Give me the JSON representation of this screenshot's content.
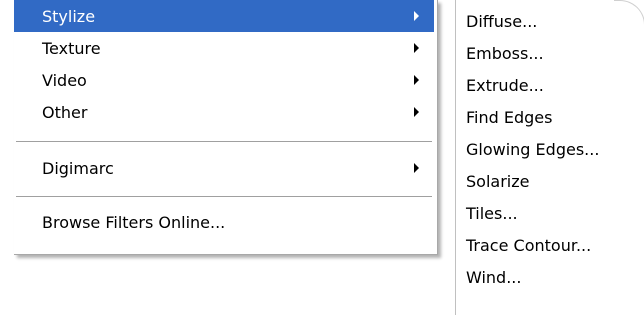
{
  "menu": {
    "items": [
      {
        "label": "Stylize"
      },
      {
        "label": "Texture"
      },
      {
        "label": "Video"
      },
      {
        "label": "Other"
      },
      {
        "label": "Digimarc"
      },
      {
        "label": "Browse Filters Online..."
      }
    ]
  },
  "submenu": {
    "items": [
      {
        "label": "Diffuse..."
      },
      {
        "label": "Emboss..."
      },
      {
        "label": "Extrude..."
      },
      {
        "label": "Find Edges"
      },
      {
        "label": "Glowing Edges..."
      },
      {
        "label": "Solarize"
      },
      {
        "label": "Tiles..."
      },
      {
        "label": "Trace Contour..."
      },
      {
        "label": "Wind..."
      }
    ]
  },
  "colors": {
    "highlight": "#316ac5",
    "highlight_text": "#ffffff"
  }
}
